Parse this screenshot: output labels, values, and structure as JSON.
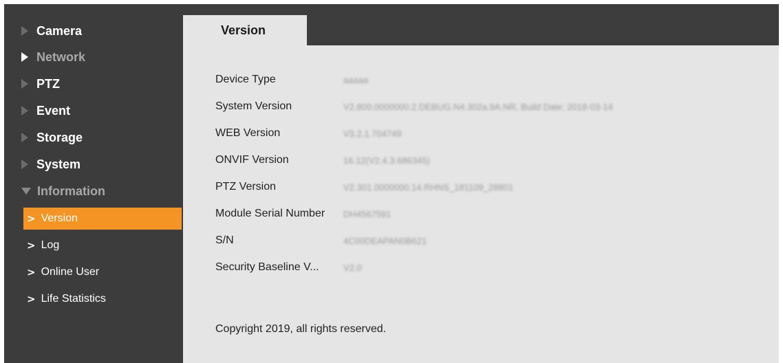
{
  "sidebar": {
    "items": [
      {
        "label": "Camera"
      },
      {
        "label": "Network"
      },
      {
        "label": "PTZ"
      },
      {
        "label": "Event"
      },
      {
        "label": "Storage"
      },
      {
        "label": "System"
      },
      {
        "label": "Information"
      }
    ],
    "subitems": [
      {
        "label": "Version",
        "active": true
      },
      {
        "label": "Log"
      },
      {
        "label": "Online User"
      },
      {
        "label": "Life Statistics"
      }
    ]
  },
  "tab": {
    "label": "Version"
  },
  "info": {
    "rows": [
      {
        "key": "Device Type",
        "value": "aaaaa"
      },
      {
        "key": "System Version",
        "value": "V2.800.0000000.2.DEBUG.N4.302a.9A.NR, Build Date: 2018-03-14"
      },
      {
        "key": "WEB Version",
        "value": "V3.2.1.704749"
      },
      {
        "key": "ONVIF Version",
        "value": "16.12(V2.4.3.686345)"
      },
      {
        "key": "PTZ Version",
        "value": "V2.301.0000000.14.RHNS_181109_28801"
      },
      {
        "key": "Module Serial Number",
        "value": "DH4567591"
      },
      {
        "key": "S/N",
        "value": "4C00DEAPAN0B621"
      },
      {
        "key": "Security Baseline V...",
        "value": "V2.0"
      }
    ]
  },
  "footer": {
    "copyright": "Copyright 2019, all rights reserved."
  },
  "colors": {
    "accent": "#f39424",
    "sidebar": "#3c3c3c",
    "panel": "#e5e5e5"
  }
}
